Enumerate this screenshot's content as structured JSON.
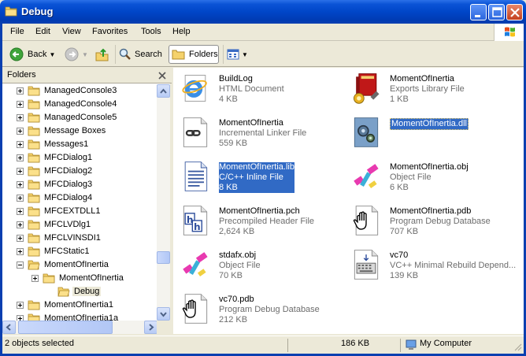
{
  "window": {
    "title": "Debug",
    "colors": {
      "titlebar": "#0046c8",
      "selection": "#316ac5"
    }
  },
  "menu": {
    "items": [
      "File",
      "Edit",
      "View",
      "Favorites",
      "Tools",
      "Help"
    ]
  },
  "toolbar": {
    "back_label": "Back",
    "search_label": "Search",
    "folders_label": "Folders"
  },
  "folders_pane": {
    "title": "Folders",
    "tree": [
      {
        "label": "ManagedConsole3",
        "expander": "plus",
        "indent": 0
      },
      {
        "label": "ManagedConsole4",
        "expander": "plus",
        "indent": 0
      },
      {
        "label": "ManagedConsole5",
        "expander": "plus",
        "indent": 0
      },
      {
        "label": "Message Boxes",
        "expander": "plus",
        "indent": 0
      },
      {
        "label": "Messages1",
        "expander": "plus",
        "indent": 0
      },
      {
        "label": "MFCDialog1",
        "expander": "plus",
        "indent": 0
      },
      {
        "label": "MFCDialog2",
        "expander": "plus",
        "indent": 0
      },
      {
        "label": "MFCDialog3",
        "expander": "plus",
        "indent": 0
      },
      {
        "label": "MFCDialog4",
        "expander": "plus",
        "indent": 0
      },
      {
        "label": "MFCEXTDLL1",
        "expander": "plus",
        "indent": 0
      },
      {
        "label": "MFCLVDlg1",
        "expander": "plus",
        "indent": 0
      },
      {
        "label": "MFCLVINSDI1",
        "expander": "plus",
        "indent": 0
      },
      {
        "label": "MFCStatic1",
        "expander": "plus",
        "indent": 0
      },
      {
        "label": "MomentOfInertia",
        "expander": "minus",
        "indent": 0
      },
      {
        "label": "MomentOfInertia",
        "expander": "plus",
        "indent": 1
      },
      {
        "label": "Debug",
        "expander": "none",
        "indent": 2,
        "selected": true
      },
      {
        "label": "MomentOfInertia1",
        "expander": "plus",
        "indent": 0
      },
      {
        "label": "MomentOfInertia1a",
        "expander": "plus",
        "indent": 0
      }
    ]
  },
  "files": [
    {
      "name": "BuildLog",
      "type": "HTML Document",
      "size": "4 KB",
      "icon": "ie-document-icon"
    },
    {
      "name": "MomentOfInertia",
      "type": "Exports Library File",
      "size": "1 KB",
      "icon": "exports-library-icon"
    },
    {
      "name": "MomentOfInertia",
      "type": "Incremental Linker File",
      "size": "559 KB",
      "icon": "linker-file-icon"
    },
    {
      "name": "MomentOfInertia.dll",
      "type": "",
      "size": "",
      "icon": "dll-gear-icon",
      "selected": "name"
    },
    {
      "name": "MomentOfInertia.lib",
      "type": "C/C++ Inline File",
      "size": "8 KB",
      "icon": "text-document-icon",
      "selected": "all"
    },
    {
      "name": "MomentOfInertia.obj",
      "type": "Object File",
      "size": "6 KB",
      "icon": "object-file-icon"
    },
    {
      "name": "MomentOfInertia.pch",
      "type": "Precompiled Header File",
      "size": "2,624 KB",
      "icon": "header-file-icon"
    },
    {
      "name": "MomentOfInertia.pdb",
      "type": "Program Debug Database",
      "size": "707 KB",
      "icon": "debug-database-icon"
    },
    {
      "name": "stdafx.obj",
      "type": "Object File",
      "size": "70 KB",
      "icon": "object-file-icon"
    },
    {
      "name": "vc70",
      "type": "VC++ Minimal Rebuild Depend...",
      "size": "139 KB",
      "icon": "rebuild-dependency-icon"
    },
    {
      "name": "vc70.pdb",
      "type": "Program Debug Database",
      "size": "212 KB",
      "icon": "debug-database-icon"
    }
  ],
  "statusbar": {
    "selection": "2 objects selected",
    "size": "186 KB",
    "location": "My Computer"
  }
}
